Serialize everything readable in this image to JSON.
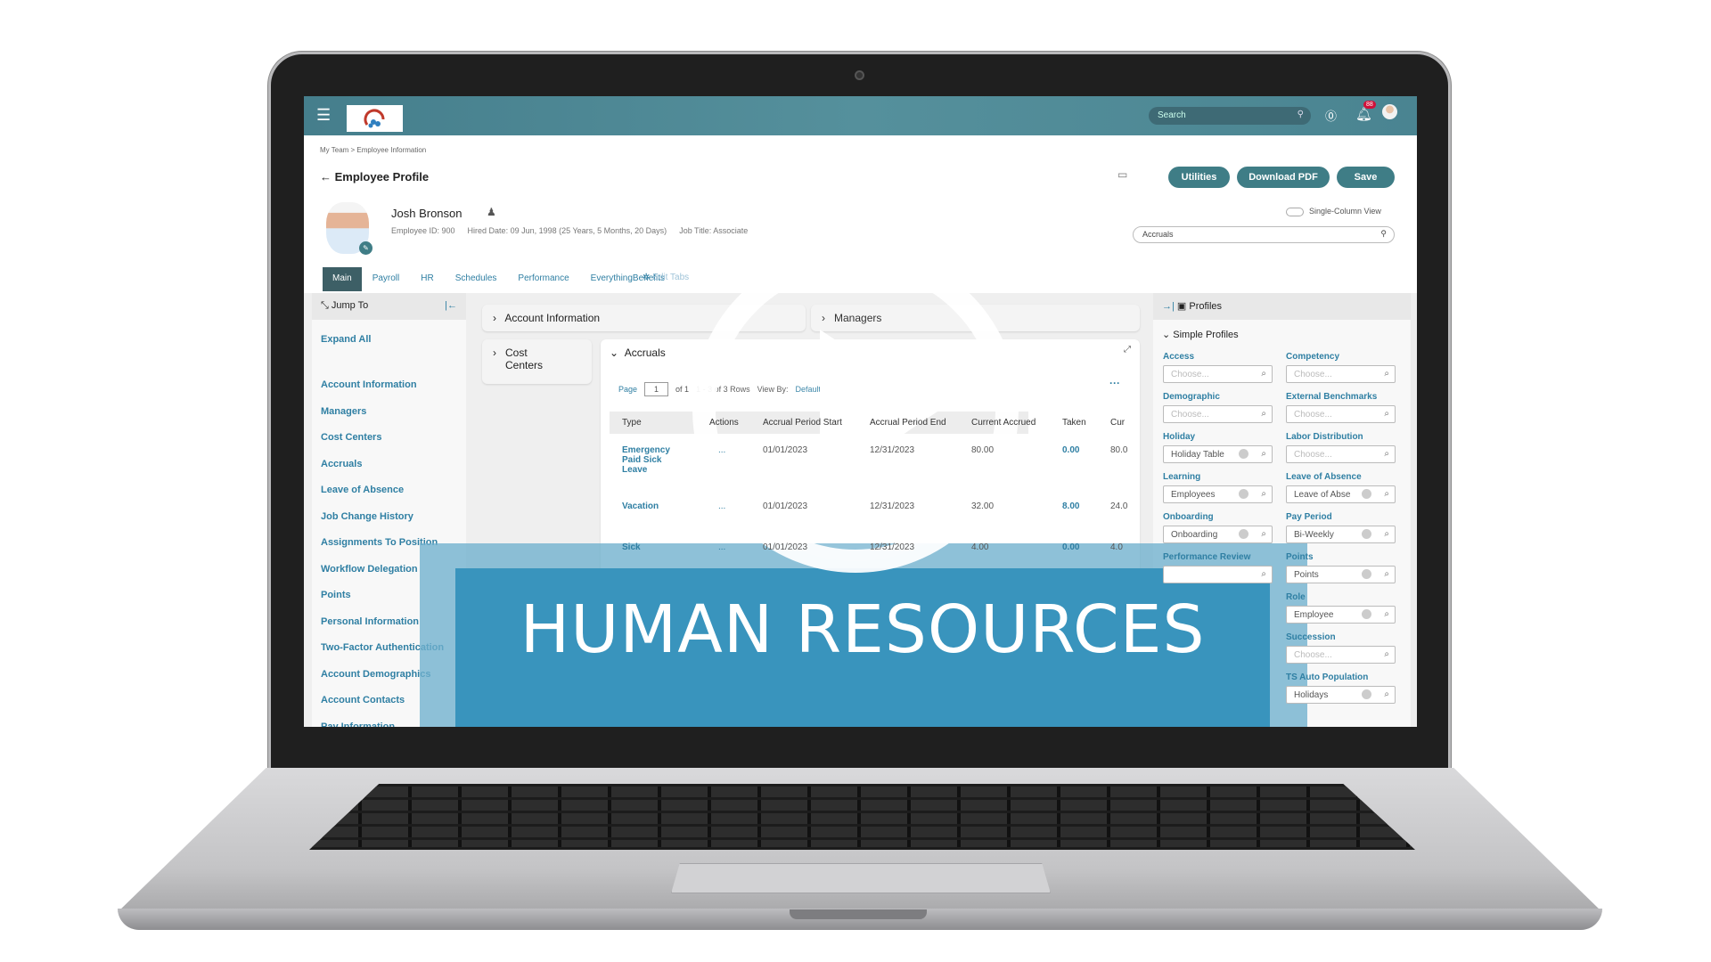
{
  "header": {
    "search_placeholder": "Search",
    "notification_count": "88"
  },
  "breadcrumb": "My Team > Employee Information",
  "page_title": "Employee Profile",
  "buttons": {
    "utilities": "Utilities",
    "download_pdf": "Download PDF",
    "save": "Save"
  },
  "employee": {
    "name": "Josh Bronson",
    "id": "Employee ID: 900",
    "hired": "Hired Date: 09 Jun, 1998 (25 Years, 5 Months, 20 Days)",
    "job_title": "Job Title: Associate"
  },
  "single_column_label": "Single-Column View",
  "section_search": "Accruals",
  "tabs": [
    "Main",
    "Payroll",
    "HR",
    "Schedules",
    "Performance",
    "EverythingBenefits"
  ],
  "edit_tabs": "Edit Tabs",
  "jump": {
    "title": "Jump To",
    "expand_all": "Expand All",
    "items": [
      "Account Information",
      "Managers",
      "Cost Centers",
      "Accruals",
      "Leave of Absence",
      "Job Change History",
      "Assignments To Position",
      "Workflow Delegation",
      "Points",
      "Personal Information",
      "Two-Factor Authentication",
      "Account Demographics",
      "Account Contacts",
      "Pay Information"
    ]
  },
  "cards": {
    "account_info": "Account Information",
    "managers": "Managers",
    "cost_centers": "Cost Centers",
    "accruals": "Accruals"
  },
  "pager": {
    "page_label": "Page",
    "page": "1",
    "of": "of 1",
    "rows": "1 - 3 of 3 Rows",
    "view_by": "View By:",
    "view_value": "Default"
  },
  "table": {
    "columns": [
      "Type",
      "Actions",
      "Accrual Period Start",
      "Accrual Period End",
      "Current Accrued",
      "Taken",
      "Cur"
    ],
    "rows": [
      [
        "Emergency Paid Sick Leave",
        "...",
        "01/01/2023",
        "12/31/2023",
        "80.00",
        "0.00",
        "80.0"
      ],
      [
        "Vacation",
        "...",
        "01/01/2023",
        "12/31/2023",
        "32.00",
        "8.00",
        "24.0"
      ],
      [
        "Sick",
        "...",
        "01/01/2023",
        "12/31/2023",
        "4.00",
        "0.00",
        "4.0"
      ]
    ]
  },
  "profiles": {
    "title": "Profiles",
    "section": "Simple Profiles",
    "fields": [
      {
        "label": "Access",
        "value": "",
        "placeholder": "Choose..."
      },
      {
        "label": "Competency",
        "value": "",
        "placeholder": "Choose..."
      },
      {
        "label": "Demographic",
        "value": "",
        "placeholder": "Choose..."
      },
      {
        "label": "External Benchmarks",
        "value": "",
        "placeholder": "Choose..."
      },
      {
        "label": "Holiday",
        "value": "Holiday Table"
      },
      {
        "label": "Labor Distribution",
        "value": "",
        "placeholder": "Choose..."
      },
      {
        "label": "Learning",
        "value": "Employees"
      },
      {
        "label": "Leave of Absence",
        "value": "Leave of Abse"
      },
      {
        "label": "Onboarding",
        "value": "Onboarding"
      },
      {
        "label": "Pay Period",
        "value": "Bi-Weekly"
      },
      {
        "label": "Performance Review",
        "value": ""
      },
      {
        "label": "Points",
        "value": "Points"
      },
      {
        "label": "",
        "value": ""
      },
      {
        "label": "Role",
        "value": "Employee"
      },
      {
        "label": "",
        "value": ""
      },
      {
        "label": "Succession",
        "value": "",
        "placeholder": "Choose..."
      },
      {
        "label": "",
        "value": ""
      },
      {
        "label": "TS Auto Population",
        "value": "Holidays"
      }
    ]
  },
  "overlay": {
    "title": "HUMAN RESOURCES"
  },
  "colors": {
    "header": "#4f8a97",
    "accent": "#2f7fa3",
    "button": "#3f7d86",
    "overlay": "#3d95bd",
    "badge": "#d0103a"
  }
}
